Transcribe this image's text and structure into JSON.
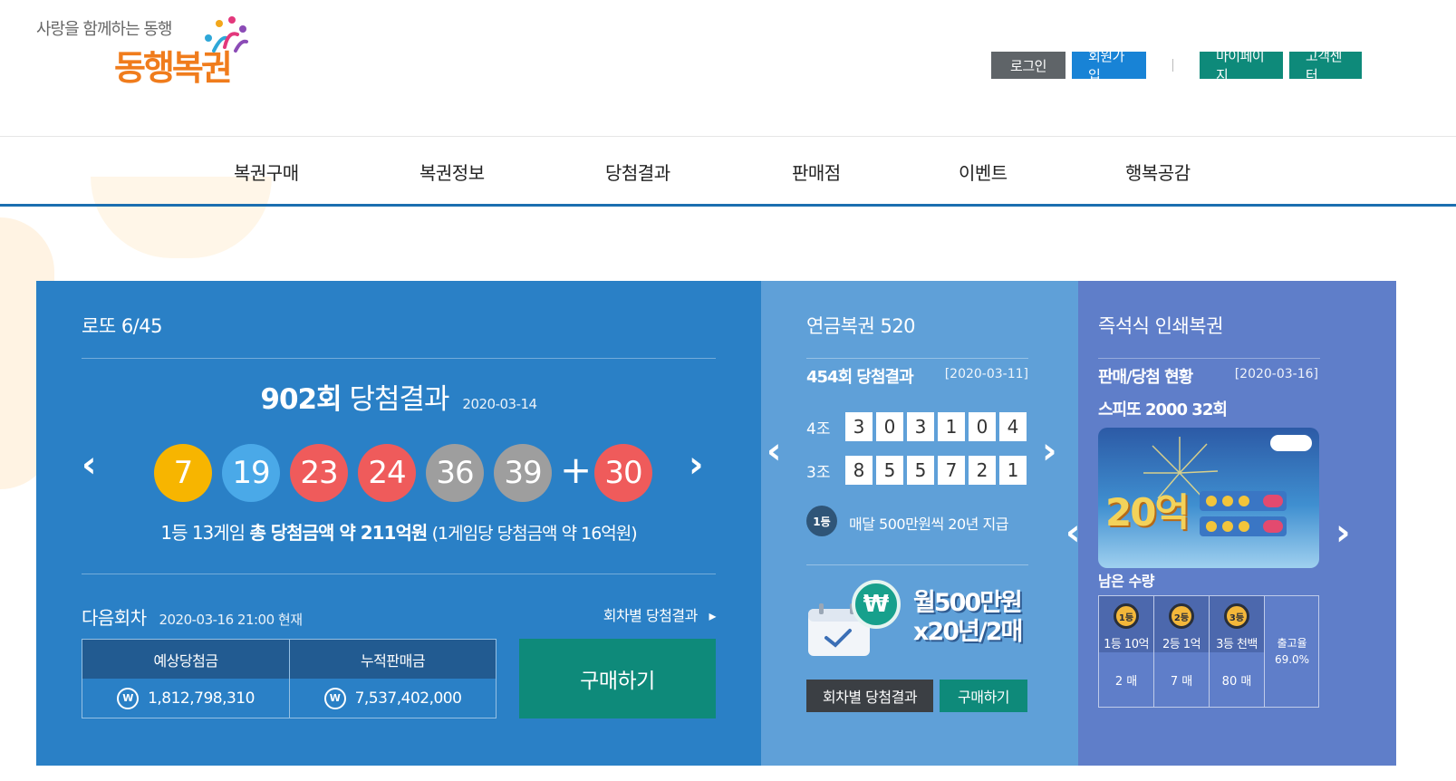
{
  "header": {
    "logo_tagline": "사랑을 함께하는 동행",
    "logo_name": "동행복권",
    "buttons": {
      "login": "로그인",
      "signup": "회원가입",
      "mypage": "마이페이지",
      "support": "고객센터"
    }
  },
  "nav": [
    "복권구매",
    "복권정보",
    "당첨결과",
    "판매점",
    "이벤트",
    "행복공감"
  ],
  "lotto": {
    "title": "로또 6/45",
    "round": "902회",
    "round_suffix": "당첨결과",
    "round_date": "2020-03-14",
    "numbers": [
      "7",
      "19",
      "23",
      "24",
      "36",
      "39"
    ],
    "bonus": "30",
    "plus": "+",
    "ball_colors": [
      "#f7b500",
      "#4aa9e8",
      "#ef5b5b",
      "#ef5b5b",
      "#9e9e9e",
      "#9e9e9e"
    ],
    "bonus_color": "#ef5b5b",
    "prize_prefix": "1등 13게임",
    "prize_main": "총 당첨금액 약 211억원",
    "prize_suffix": "(1게임당 당첨금액 약 16억원)",
    "next_label": "다음회차",
    "next_date": "2020-03-16 21:00 현재",
    "result_link": "회차별 당첨결과",
    "expected_label": "예상당첨금",
    "expected_value": "1,812,798,310",
    "accum_label": "누적판매금",
    "accum_value": "7,537,402,000",
    "won_symbol": "W",
    "buy": "구매하기"
  },
  "pension": {
    "title": "연금복권 520",
    "round": "454회 당첨결과",
    "date": "[2020-03-11]",
    "rows": [
      {
        "label": "4조",
        "digits": [
          "3",
          "0",
          "3",
          "1",
          "0",
          "4"
        ]
      },
      {
        "label": "3조",
        "digits": [
          "8",
          "5",
          "5",
          "7",
          "2",
          "1"
        ]
      }
    ],
    "badge": "1등",
    "desc": "매달 500만원씩 20년 지급",
    "ad_line1": "월500만원",
    "ad_line2": "x20년/2매",
    "ad_icon": "₩",
    "btn_results": "회차별 당첨결과",
    "btn_buy": "구매하기"
  },
  "instant": {
    "title": "즉석식 인쇄복권",
    "subtitle": "판매/당첨 현황",
    "date": "[2020-03-16]",
    "game": "스피또 2000 32회",
    "ticket_big": "20억",
    "remain_label": "남은 수량",
    "prizes": [
      {
        "medal": "1등",
        "label": "1등 10억",
        "count": "2 매"
      },
      {
        "medal": "2등",
        "label": "2등 1억",
        "count": "7 매"
      },
      {
        "medal": "3등",
        "label": "3등 천백",
        "count": "80 매"
      }
    ],
    "rate_label": "출고율",
    "rate_value": "69.0%"
  }
}
